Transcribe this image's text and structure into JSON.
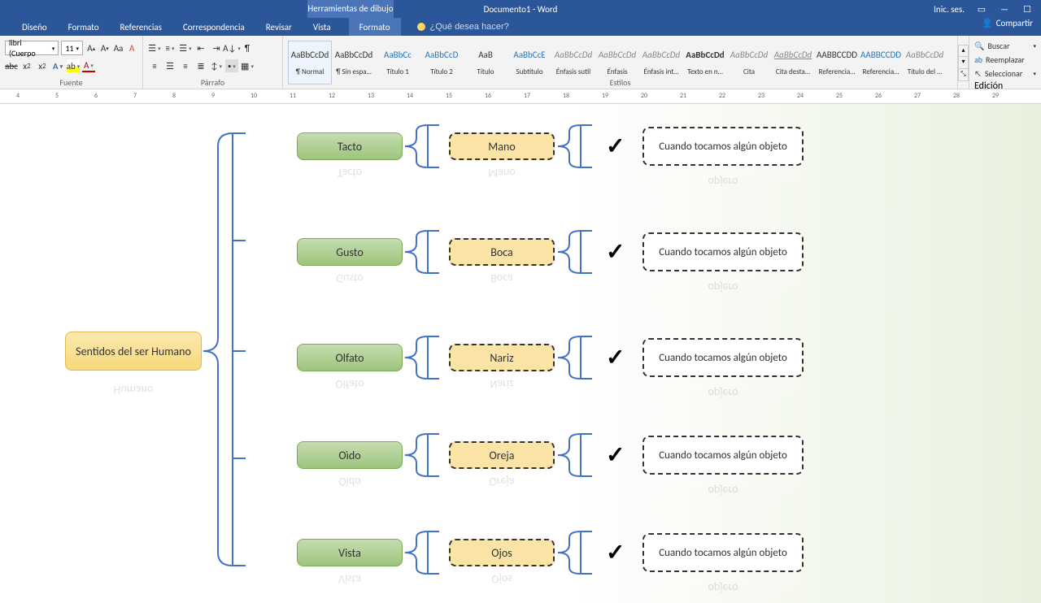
{
  "titlebar": {
    "drawing_tools": "Herramientas de dibujo",
    "doc_title": "Documento1 - Word",
    "signin": "Inic. ses."
  },
  "tabs": {
    "items": [
      "Diseño",
      "Formato",
      "Referencias",
      "Correspondencia",
      "Revisar",
      "Vista"
    ],
    "format_tab": "Formato",
    "tellme_placeholder": "¿Qué desea hacer?",
    "share": "Compartir"
  },
  "ribbon": {
    "font": {
      "name": "libri (Cuerpo",
      "size": "11",
      "label": "Fuente"
    },
    "para": {
      "label": "Párrafo"
    },
    "styles": {
      "label": "Estilos",
      "items": [
        {
          "preview": "AaBbCcDd",
          "name": "¶ Normal",
          "cls": ""
        },
        {
          "preview": "AaBbCcDd",
          "name": "¶ Sin espa…",
          "cls": ""
        },
        {
          "preview": "AaBbCc",
          "name": "Título 1",
          "cls": "blue"
        },
        {
          "preview": "AaBbCcD",
          "name": "Título 2",
          "cls": "blue"
        },
        {
          "preview": "AaB",
          "name": "Título",
          "cls": ""
        },
        {
          "preview": "AaBbCcE",
          "name": "Subtítulo",
          "cls": "blue"
        },
        {
          "preview": "AaBbCcDd",
          "name": "Énfasis sutil",
          "cls": "gray"
        },
        {
          "preview": "AaBbCcDd",
          "name": "Énfasis",
          "cls": "gray"
        },
        {
          "preview": "AaBbCcDd",
          "name": "Énfasis int…",
          "cls": "gray"
        },
        {
          "preview": "AaBbCcDd",
          "name": "Texto en n…",
          "cls": "bold"
        },
        {
          "preview": "AaBbCcDd",
          "name": "Cita",
          "cls": "gray"
        },
        {
          "preview": "AaBbCcDd",
          "name": "Cita desta…",
          "cls": "gray ul"
        },
        {
          "preview": "AABBCCDD",
          "name": "Referencia…",
          "cls": "sc"
        },
        {
          "preview": "AABBCCDD",
          "name": "Referencia…",
          "cls": "blue sc"
        },
        {
          "preview": "AaBbCcDd",
          "name": "Título del …",
          "cls": "gray"
        }
      ]
    },
    "edit": {
      "find": "Buscar",
      "replace": "Reemplazar",
      "select": "Seleccionar",
      "label": "Edición"
    }
  },
  "ruler": {
    "numbers": [
      "4",
      "5",
      "6",
      "7",
      "8",
      "9",
      "10",
      "11",
      "12",
      "13",
      "14",
      "15",
      "16",
      "17",
      "18",
      "19",
      "20",
      "21",
      "22",
      "23",
      "24",
      "25",
      "26",
      "27",
      "28",
      "29"
    ]
  },
  "diagram": {
    "root": "Sentidos del ser Humano",
    "rows": [
      {
        "sense": "Tacto",
        "organ": "Mano",
        "desc": "Cuando tocamos algún objeto"
      },
      {
        "sense": "Gusto",
        "organ": "Boca",
        "desc": "Cuando tocamos algún objeto"
      },
      {
        "sense": "Olfato",
        "organ": "Nariz",
        "desc": "Cuando tocamos algún objeto"
      },
      {
        "sense": "Oìdo",
        "organ": "Oreja",
        "desc": "Cuando tocamos algún objeto"
      },
      {
        "sense": "Vista",
        "organ": "Ojos",
        "desc": "Cuando tocamos algún objeto"
      }
    ],
    "reflection_word": "opjero"
  }
}
